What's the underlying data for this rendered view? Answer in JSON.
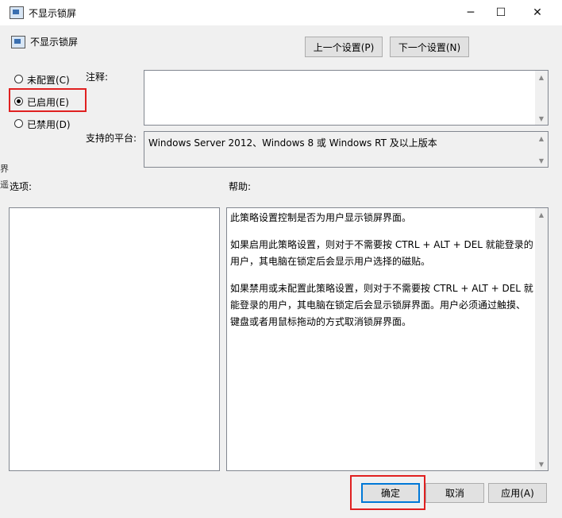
{
  "window": {
    "title": "不显示锁屏",
    "minimize": "─",
    "maximize": "☐",
    "close": "✕"
  },
  "header": {
    "policy_name": "不显示锁屏"
  },
  "nav": {
    "prev": "上一个设置(P)",
    "next": "下一个设置(N)"
  },
  "state": {
    "options": [
      {
        "label": "未配置(C)",
        "selected": false
      },
      {
        "label": "已启用(E)",
        "selected": true
      },
      {
        "label": "已禁用(D)",
        "selected": false
      }
    ]
  },
  "comment": {
    "label": "注释:",
    "value": ""
  },
  "platform": {
    "label": "支持的平台:",
    "value": "Windows Server 2012、Windows 8 或 Windows RT 及以上版本"
  },
  "options_label": "选项:",
  "help": {
    "label": "帮助:",
    "paragraphs": [
      "此策略设置控制是否为用户显示锁屏界面。",
      "如果启用此策略设置，则对于不需要按 CTRL + ALT + DEL 就能登录的用户，其电脑在锁定后会显示用户选择的磁贴。",
      "如果禁用或未配置此策略设置，则对于不需要按 CTRL + ALT + DEL 就能登录的用户，其电脑在锁定后会显示锁屏界面。用户必须通过触摸、键盘或者用鼠标拖动的方式取消锁屏界面。"
    ]
  },
  "footer": {
    "ok": "确定",
    "cancel": "取消",
    "apply": "应用(A)"
  },
  "background_fragments": {
    "left1": "界",
    "left2": "遥"
  },
  "colors": {
    "highlight": "#e02020",
    "button_bg": "#e1e1e1"
  }
}
